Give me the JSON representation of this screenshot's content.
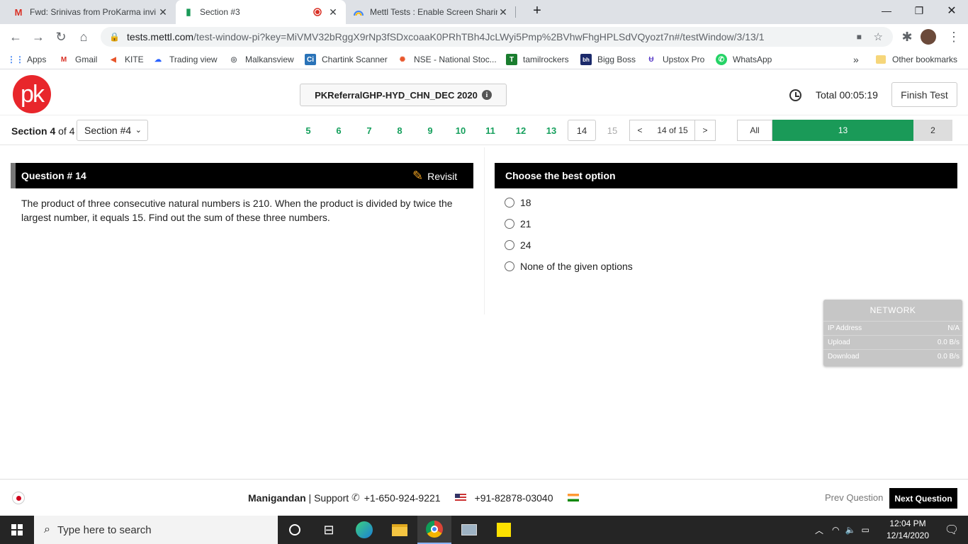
{
  "browser": {
    "tabs": [
      {
        "title": "Fwd: Srinivas from ProKarma invi",
        "icon": "gmail-icon",
        "close": "✕"
      },
      {
        "title": "Section #3",
        "icon": "mettl-icon",
        "close": "✕",
        "recording": true
      },
      {
        "title": "Mettl Tests : Enable Screen Sharin",
        "icon": "mettl-rainbow-icon",
        "close": "✕"
      }
    ],
    "new_tab": "+",
    "window_controls": {
      "minimize": "—",
      "restore": "❐",
      "close": "✕"
    },
    "url_host": "tests.mettl.com",
    "url_path": "/test-window-pi?key=MiVMV32bRggX9rNp3fSDxcoaaK0PRhTBh4JcLWyi5Pmp%2BVhwFhgHPLSdVQyozt7n#/testWindow/3/13/1",
    "bookmarks": [
      {
        "label": "Apps",
        "icon": "apps-grid-icon"
      },
      {
        "label": "Gmail",
        "icon": "gmail-icon"
      },
      {
        "label": "KITE",
        "icon": "kite-icon"
      },
      {
        "label": "Trading view",
        "icon": "tradingview-icon"
      },
      {
        "label": "Malkansview",
        "icon": "malkansview-icon"
      },
      {
        "label": "Chartink Scanner",
        "icon": "chartink-icon"
      },
      {
        "label": "NSE - National Stoc...",
        "icon": "nse-icon"
      },
      {
        "label": "tamilrockers",
        "icon": "tamilrockers-icon"
      },
      {
        "label": "Bigg Boss",
        "icon": "biggboss-icon"
      },
      {
        "label": "Upstox Pro",
        "icon": "upstox-icon"
      },
      {
        "label": "WhatsApp",
        "icon": "whatsapp-icon"
      }
    ],
    "bookmarks_overflow": "»",
    "other_bookmarks": "Other bookmarks"
  },
  "header": {
    "logo_text": "pk",
    "test_name": "PKReferralGHP-HYD_CHN_DEC 2020",
    "timer_label": "Total 00:05:19",
    "finish_label": "Finish Test"
  },
  "nav": {
    "section_prefix": "Section 4",
    "section_suffix": " of 4",
    "section_select": "Section #4",
    "questions": [
      "5",
      "6",
      "7",
      "8",
      "9",
      "10",
      "11",
      "12",
      "13",
      "14",
      "15"
    ],
    "current_question": "14",
    "prev": "<",
    "page_label": "14 of 15",
    "next": ">",
    "filter_all": "All",
    "filter_answered": "13",
    "filter_remaining": "2"
  },
  "question": {
    "title": "Question # 14",
    "revisit": "Revisit",
    "text": "The product of three consecutive natural numbers is 210. When the product is divided by twice the largest number, it equals 15. Find out the sum of these three numbers."
  },
  "options": {
    "title": "Choose the best option",
    "items": [
      "18",
      "21",
      "24",
      "None of the given options"
    ]
  },
  "network": {
    "title": "NETWORK",
    "rows": [
      {
        "label": "IP Address",
        "value": "N/A"
      },
      {
        "label": "Upload",
        "value": "0.0 B/s"
      },
      {
        "label": "Download",
        "value": "0.0 B/s"
      }
    ]
  },
  "footer": {
    "user": "Manigandan",
    "support_label": " | Support ",
    "phone_us": "+1-650-924-9221",
    "phone_in": "+91-82878-03040",
    "prev_question": "Prev Question",
    "next_question": "Next Question"
  },
  "taskbar": {
    "search_placeholder": "Type here to search",
    "time": "12:04 PM",
    "date": "12/14/2020"
  },
  "colors": {
    "answered_green": "#1a9a58",
    "logo_red": "#e8262b",
    "question_num_green": "#16a05d"
  }
}
